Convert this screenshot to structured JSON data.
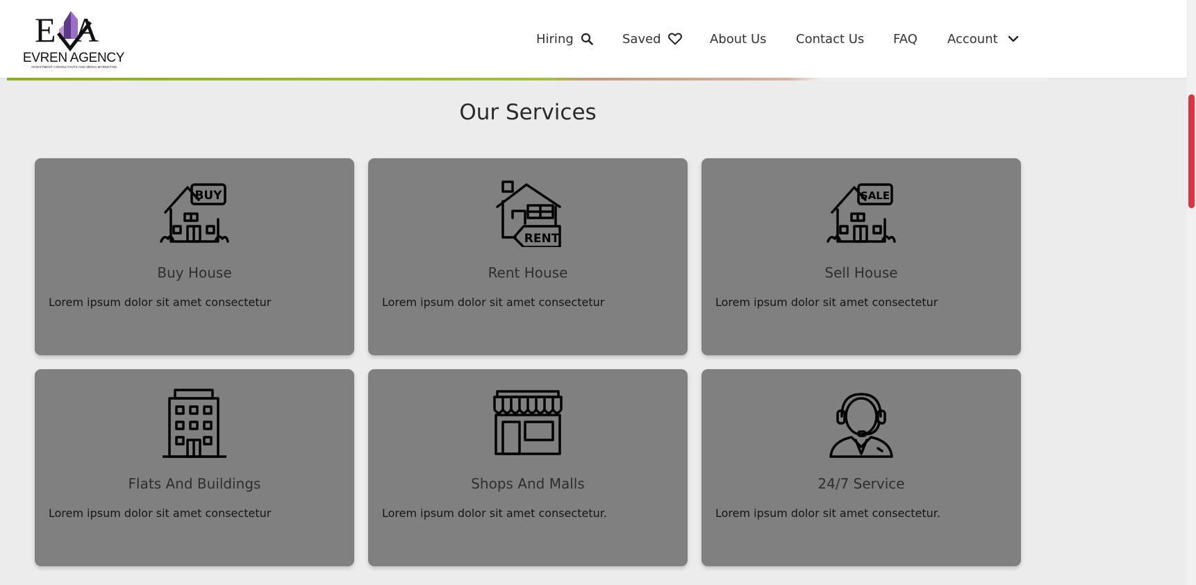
{
  "brand": {
    "name": "EVREN AGENCY",
    "tagline": "INVESTMENT CONSULTANTS AND MEDIA MARKETING",
    "mark": "EA"
  },
  "nav": {
    "hiring": {
      "label": "Hiring",
      "icon": "search-icon"
    },
    "saved": {
      "label": "Saved",
      "icon": "heart-icon"
    },
    "about": {
      "label": "About Us"
    },
    "contact": {
      "label": "Contact Us"
    },
    "faq": {
      "label": "FAQ"
    },
    "account": {
      "label": "Account",
      "icon": "chevron-down-icon"
    }
  },
  "services": {
    "title": "Our Services",
    "cards": [
      {
        "title": "Buy House",
        "desc": "Lorem ipsum dolor sit amet consectetur",
        "icon": "house-buy-sign-icon",
        "sign": "BUY"
      },
      {
        "title": "Rent House",
        "desc": "Lorem ipsum dolor sit amet consectetur",
        "icon": "house-rent-sign-icon",
        "sign": "RENT"
      },
      {
        "title": "Sell House",
        "desc": "Lorem ipsum dolor sit amet consectetur",
        "icon": "house-sale-sign-icon",
        "sign": "SALE"
      },
      {
        "title": "Flats And Buildings",
        "desc": "Lorem ipsum dolor sit amet consectetur",
        "icon": "building-icon"
      },
      {
        "title": "Shops And Malls",
        "desc": "Lorem ipsum dolor sit amet consectetur.",
        "icon": "shop-awning-icon"
      },
      {
        "title": "24/7 Service",
        "desc": "Lorem ipsum dolor sit amet consectetur.",
        "icon": "support-agent-headset-icon"
      }
    ]
  },
  "colors": {
    "card_bg": "#808080",
    "page_bg": "#ececec",
    "scroll_thumb": "#e0323f",
    "logo_purple": "#7b4fa8"
  }
}
